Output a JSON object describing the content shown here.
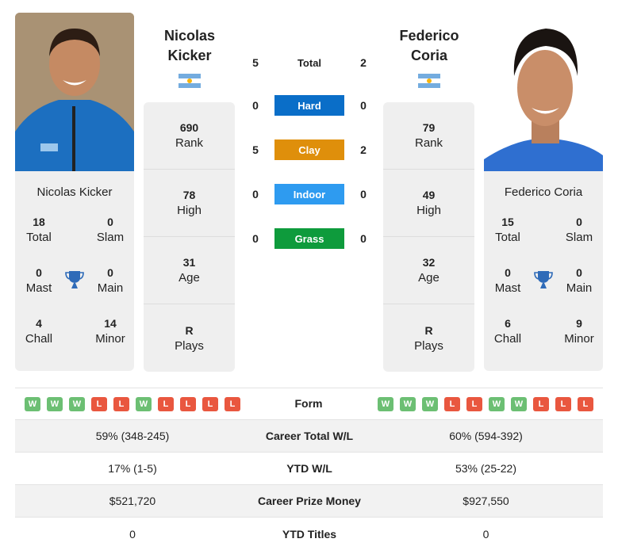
{
  "player1": {
    "name_line1": "Nicolas",
    "name_line2": "Kicker",
    "full_name": "Nicolas Kicker",
    "country_flag": "argentina-flag",
    "stats": [
      {
        "value": "690",
        "label": "Rank"
      },
      {
        "value": "78",
        "label": "High"
      },
      {
        "value": "31",
        "label": "Age"
      },
      {
        "value": "R",
        "label": "Plays"
      }
    ],
    "titles": {
      "total": {
        "value": "18",
        "label": "Total"
      },
      "slam": {
        "value": "0",
        "label": "Slam"
      },
      "mast": {
        "value": "0",
        "label": "Mast"
      },
      "main": {
        "value": "0",
        "label": "Main"
      },
      "chall": {
        "value": "4",
        "label": "Chall"
      },
      "minor": {
        "value": "14",
        "label": "Minor"
      }
    },
    "form": [
      "W",
      "W",
      "W",
      "L",
      "L",
      "W",
      "L",
      "L",
      "L",
      "L"
    ]
  },
  "player2": {
    "name_line1": "Federico",
    "name_line2": "Coria",
    "full_name": "Federico Coria",
    "country_flag": "argentina-flag",
    "stats": [
      {
        "value": "79",
        "label": "Rank"
      },
      {
        "value": "49",
        "label": "High"
      },
      {
        "value": "32",
        "label": "Age"
      },
      {
        "value": "R",
        "label": "Plays"
      }
    ],
    "titles": {
      "total": {
        "value": "15",
        "label": "Total"
      },
      "slam": {
        "value": "0",
        "label": "Slam"
      },
      "mast": {
        "value": "0",
        "label": "Mast"
      },
      "main": {
        "value": "0",
        "label": "Main"
      },
      "chall": {
        "value": "6",
        "label": "Chall"
      },
      "minor": {
        "value": "9",
        "label": "Minor"
      }
    },
    "form": [
      "W",
      "W",
      "W",
      "L",
      "L",
      "W",
      "W",
      "L",
      "L",
      "L"
    ]
  },
  "h2h": {
    "total": {
      "label": "Total",
      "p1": "5",
      "p2": "2"
    },
    "surfaces": [
      {
        "label": "Hard",
        "p1": "0",
        "p2": "0",
        "color": "#0a6ec8"
      },
      {
        "label": "Clay",
        "p1": "5",
        "p2": "2",
        "color": "#df8f0b"
      },
      {
        "label": "Indoor",
        "p1": "0",
        "p2": "0",
        "color": "#2e9bf0"
      },
      {
        "label": "Grass",
        "p1": "0",
        "p2": "0",
        "color": "#0e9b3c"
      }
    ]
  },
  "comparison": {
    "form_label": "Form",
    "rows": [
      {
        "label": "Career Total W/L",
        "p1": "59% (348-245)",
        "p2": "60% (594-392)"
      },
      {
        "label": "YTD W/L",
        "p1": "17% (1-5)",
        "p2": "53% (25-22)"
      },
      {
        "label": "Career Prize Money",
        "p1": "$521,720",
        "p2": "$927,550"
      },
      {
        "label": "YTD Titles",
        "p1": "0",
        "p2": "0"
      }
    ]
  }
}
